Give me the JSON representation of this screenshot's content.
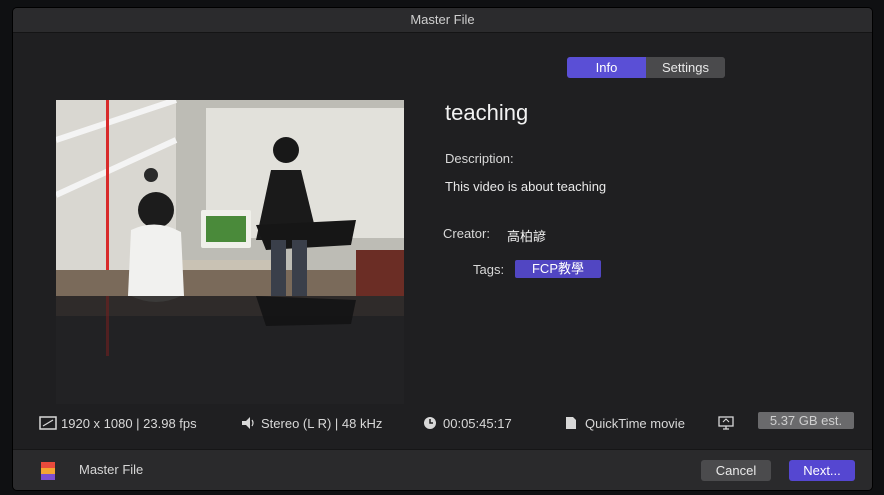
{
  "window": {
    "title": "Master File"
  },
  "segmented": {
    "info_label": "Info",
    "settings_label": "Settings",
    "selected": "Info"
  },
  "details": {
    "title": "teaching",
    "description_label": "Description:",
    "description_value": "This video is about teaching",
    "creator_label": "Creator:",
    "creator_value": "高柏諺",
    "tags_label": "Tags:",
    "tag": "FCP教學"
  },
  "info_bar": {
    "resolution": "1920 x 1080 | 23.98 fps",
    "audio": "Stereo (L R) | 48 kHz",
    "duration": "00:05:45:17",
    "format": "QuickTime movie",
    "size_estimate": "5.37 GB est."
  },
  "footer": {
    "title": "Master File",
    "cancel_label": "Cancel",
    "next_label": "Next..."
  },
  "icons": {
    "resolution": "aspect-ratio-icon",
    "audio": "speaker-icon",
    "duration": "clock-icon",
    "format": "document-icon",
    "destination": "monitor-icon",
    "app": "master-file-icon"
  },
  "colors": {
    "accent": "#5547d1",
    "window_bg": "#1f1f21",
    "titlebar_bg": "#2b2b2d"
  }
}
